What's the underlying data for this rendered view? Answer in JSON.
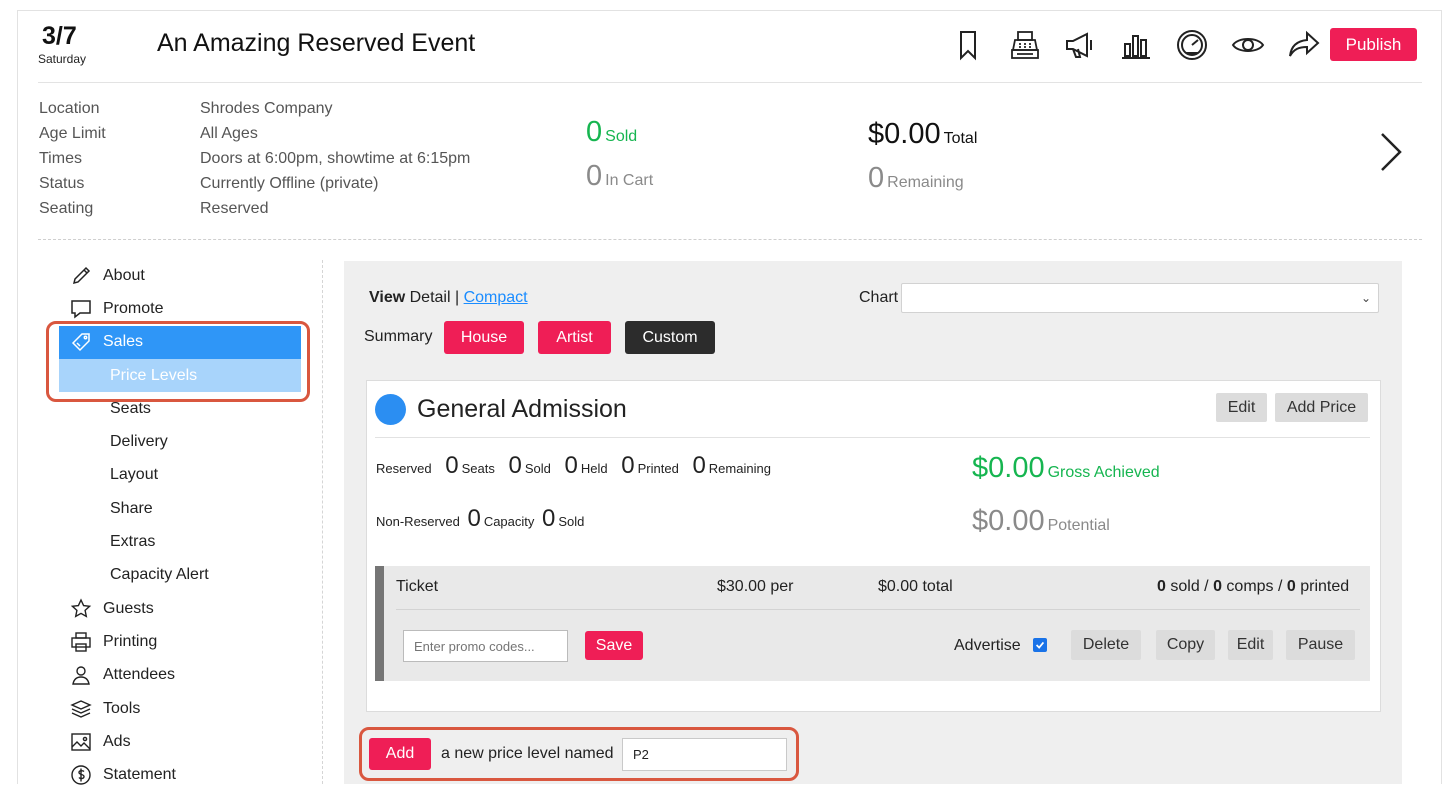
{
  "header": {
    "date_month": "3/7",
    "date_day": "Saturday",
    "title": "An Amazing Reserved Event",
    "publish_label": "Publish",
    "toolbar_icons": [
      "bookmark-icon",
      "cash-register-icon",
      "megaphone-icon",
      "bar-chart-icon",
      "dashboard-icon",
      "eye-icon",
      "share-icon"
    ]
  },
  "info": {
    "labels": [
      "Location",
      "Age Limit",
      "Times",
      "Status",
      "Seating"
    ],
    "values": [
      "Shrodes Company",
      "All Ages",
      "Doors at 6:00pm, showtime at 6:15pm",
      "Currently Offline (private)",
      "Reserved"
    ]
  },
  "stats": {
    "sold": {
      "value": "0",
      "label": "Sold"
    },
    "in_cart": {
      "value": "0",
      "label": "In Cart"
    },
    "total": {
      "value": "$0.00",
      "label": "Total"
    },
    "remaining": {
      "value": "0",
      "label": "Remaining"
    }
  },
  "sidebar": {
    "items": [
      {
        "label": "About",
        "icon": "pencil-icon"
      },
      {
        "label": "Promote",
        "icon": "speech-bubble-icon"
      },
      {
        "label": "Sales",
        "icon": "ticket-icon",
        "active": true
      },
      {
        "label": "Price Levels",
        "sub": true,
        "active": true
      },
      {
        "label": "Seats",
        "sub": true
      },
      {
        "label": "Delivery",
        "sub": true
      },
      {
        "label": "Layout",
        "sub": true
      },
      {
        "label": "Share",
        "sub": true
      },
      {
        "label": "Extras",
        "sub": true
      },
      {
        "label": "Capacity Alert",
        "sub": true
      },
      {
        "label": "Guests",
        "icon": "star-icon"
      },
      {
        "label": "Printing",
        "icon": "printer-icon"
      },
      {
        "label": "Attendees",
        "icon": "person-icon"
      },
      {
        "label": "Tools",
        "icon": "layers-icon"
      },
      {
        "label": "Ads",
        "icon": "image-icon"
      },
      {
        "label": "Statement",
        "icon": "dollar-circle-icon"
      }
    ]
  },
  "main": {
    "view_label": "View",
    "view_detail": "Detail",
    "view_sep": "|",
    "view_compact": "Compact",
    "chart_label": "Chart",
    "chart_value": "",
    "summary_label": "Summary",
    "summary_buttons": [
      "House",
      "Artist",
      "Custom"
    ],
    "card": {
      "title": "General Admission",
      "edit_label": "Edit",
      "add_price_label": "Add Price",
      "reserved_label": "Reserved",
      "reserved_stats": [
        {
          "value": "0",
          "label": "Seats"
        },
        {
          "value": "0",
          "label": "Sold"
        },
        {
          "value": "0",
          "label": "Held"
        },
        {
          "value": "0",
          "label": "Printed"
        },
        {
          "value": "0",
          "label": "Remaining"
        }
      ],
      "nonreserved_label": "Non-Reserved",
      "nonreserved_stats": [
        {
          "value": "0",
          "label": "Capacity"
        },
        {
          "value": "0",
          "label": "Sold"
        }
      ],
      "gross": {
        "value": "$0.00",
        "label": "Gross Achieved"
      },
      "potential": {
        "value": "$0.00",
        "label": "Potential"
      },
      "ticket": {
        "name": "Ticket",
        "per": "$30.00 per",
        "total": "$0.00 total",
        "sold": "0",
        "sold_label": "sold /",
        "comps": "0",
        "comps_label": "comps /",
        "printed": "0",
        "printed_label": "printed",
        "promo_placeholder": "Enter promo codes...",
        "save_label": "Save",
        "advertise_label": "Advertise",
        "advertise_checked": true,
        "actions": [
          "Delete",
          "Copy",
          "Edit",
          "Pause"
        ]
      }
    },
    "add_level": {
      "button": "Add",
      "text": "a new price level named",
      "value": "P2"
    }
  },
  "colors": {
    "accent": "#ef1e56",
    "active_nav": "#2f96f7",
    "active_sub": "#a8d4fb",
    "green": "#16b550",
    "highlight_outline": "#d9573f"
  }
}
